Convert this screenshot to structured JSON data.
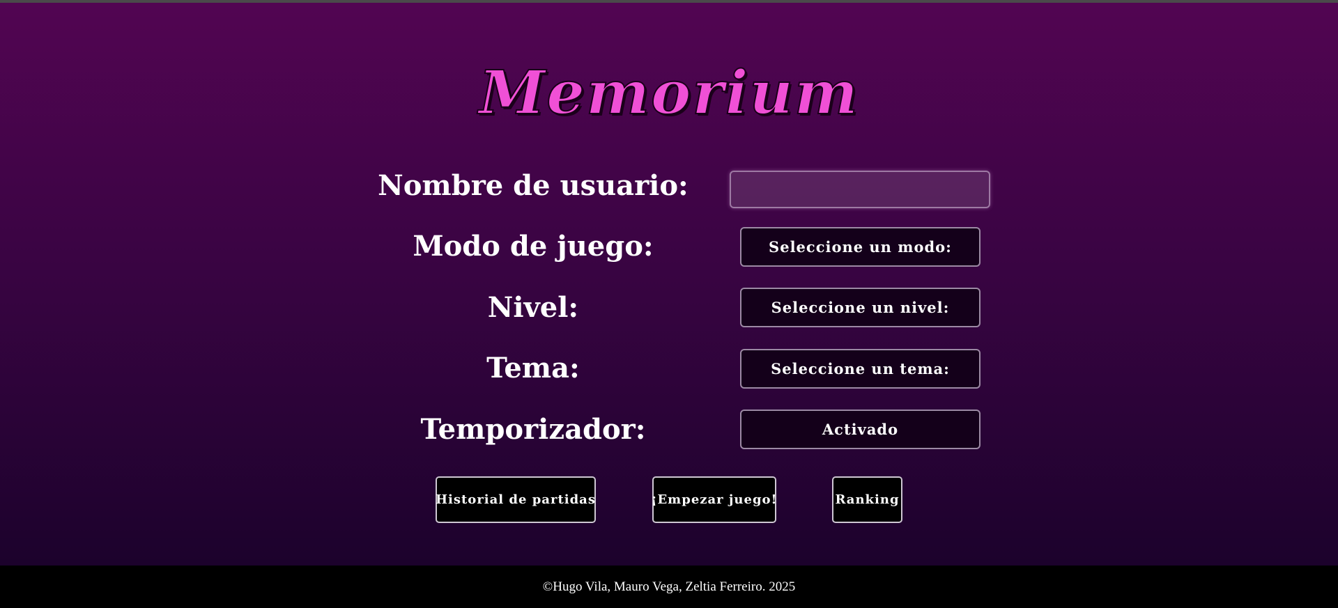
{
  "app": {
    "title": "Memorium"
  },
  "colors": {
    "title_pink": "#f050d6",
    "background_top": "#520552",
    "background_bottom": "#1c022c",
    "footer_bg": "#000000"
  },
  "form": {
    "username": {
      "label": "Nombre de usuario:",
      "value": "",
      "placeholder": ""
    },
    "mode": {
      "label": "Modo de juego:",
      "selected": "Seleccione un modo:"
    },
    "level": {
      "label": "Nivel:",
      "selected": "Seleccione un nivel:"
    },
    "theme": {
      "label": "Tema:",
      "selected": "Seleccione un tema:"
    },
    "timer": {
      "label": "Temporizador:",
      "selected": "Activado"
    }
  },
  "actions": {
    "history": "Historial de partidas",
    "start": "¡Empezar juego!",
    "ranking": "Ranking"
  },
  "footer": {
    "text": "©Hugo Vila, Mauro Vega, Zeltia Ferreiro. 2025"
  }
}
